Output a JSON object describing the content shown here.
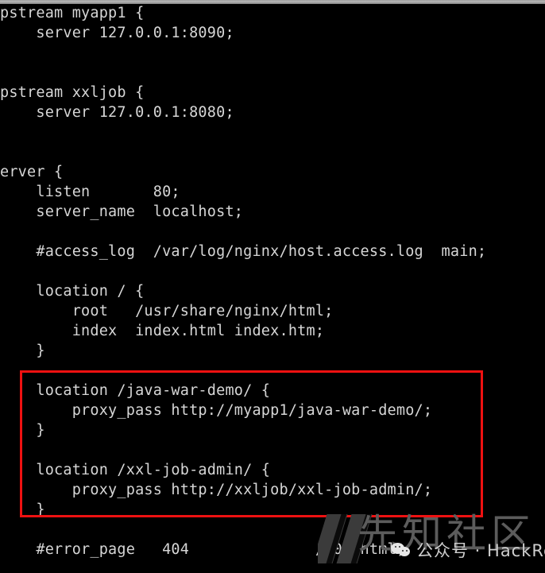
{
  "terminal": {
    "background_color": "#000000",
    "text_color": "#d6d6d6",
    "lines": [
      {
        "text": "pstream myapp1 {",
        "blank": false
      },
      {
        "text": "    server 127.0.0.1:8090;",
        "blank": false
      },
      {
        "text": "",
        "blank": true
      },
      {
        "text": "",
        "blank": true
      },
      {
        "text": "pstream xxljob {",
        "blank": false
      },
      {
        "text": "    server 127.0.0.1:8080;",
        "blank": false
      },
      {
        "text": "",
        "blank": true
      },
      {
        "text": "",
        "blank": true
      },
      {
        "text": "erver {",
        "blank": false
      },
      {
        "text": "    listen       80;",
        "blank": false
      },
      {
        "text": "    server_name  localhost;",
        "blank": false
      },
      {
        "text": "",
        "blank": true
      },
      {
        "text": "    #access_log  /var/log/nginx/host.access.log  main;",
        "blank": false
      },
      {
        "text": "",
        "blank": true
      },
      {
        "text": "    location / {",
        "blank": false
      },
      {
        "text": "        root   /usr/share/nginx/html;",
        "blank": false
      },
      {
        "text": "        index  index.html index.htm;",
        "blank": false
      },
      {
        "text": "    }",
        "blank": false
      },
      {
        "text": "",
        "blank": true
      },
      {
        "text": "    location /java-war-demo/ {",
        "blank": false
      },
      {
        "text": "        proxy_pass http://myapp1/java-war-demo/;",
        "blank": false
      },
      {
        "text": "    }",
        "blank": false
      },
      {
        "text": "",
        "blank": true
      },
      {
        "text": "    location /xxl-job-admin/ {",
        "blank": false
      },
      {
        "text": "        proxy_pass http://xxljob/xxl-job-admin/;",
        "blank": false
      },
      {
        "text": "    }",
        "blank": false
      },
      {
        "text": "",
        "blank": true
      },
      {
        "text": "    #error_page   404              /404.html;",
        "blank": false
      }
    ]
  },
  "highlight": {
    "label": "proxy-pass-location-blocks",
    "color": "#ee1111"
  },
  "watermark": {
    "logo_name": "xianzhi-logo",
    "site_name": "先知社区",
    "account_label": "公众号 · HackRead",
    "wechat_icon_name": "wechat-icon"
  }
}
